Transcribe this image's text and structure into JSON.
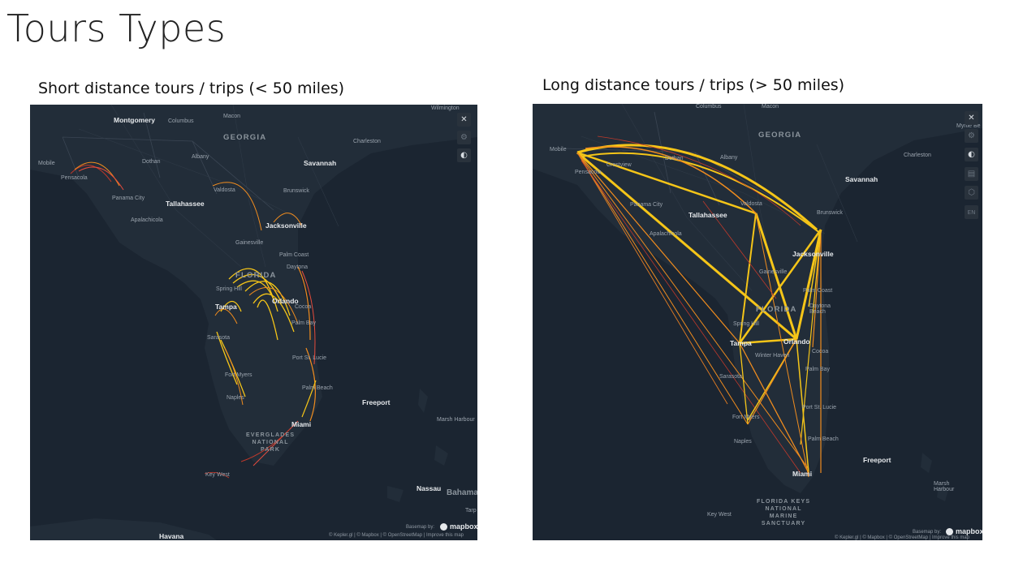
{
  "slide": {
    "title": "Tours Types"
  },
  "panels": [
    {
      "heading": "Short distance tours / trips (< 50 miles)",
      "labels": {
        "states": [
          "GEORGIA",
          "FLORIDA"
        ],
        "park": "EVERGLADES\nNATIONAL\nPARK",
        "cities_major": [
          "Tallahassee",
          "Jacksonville",
          "Savannah",
          "Montgomery",
          "Tampa",
          "Orlando",
          "Miami",
          "Freeport",
          "Havana",
          "Nassau",
          "Bahamas"
        ],
        "cities_minor": [
          "Columbus",
          "Macon",
          "Wilmington",
          "Albany",
          "Charleston",
          "Dothan",
          "Mobile",
          "Pensacola",
          "Panama City",
          "Apalachicola",
          "Valdosta",
          "Brunswick",
          "Gainesville",
          "Palm Coast",
          "Daytona",
          "Spring Hill",
          "Cocoa",
          "Palm Bay",
          "Sarasota",
          "Port St. Lucie",
          "Fort Myers",
          "Naples",
          "Palm Beach",
          "Key West",
          "Marsh Harbour",
          "Tarp"
        ]
      },
      "controls": [
        "✕",
        "⚙",
        "◐"
      ],
      "attribution": "© Kepler.gl | © Mapbox | © OpenStreetMap | Improve this map",
      "basemap_by": "Basemap by:",
      "logo": "mapbox"
    },
    {
      "heading": "Long distance tours / trips (> 50 miles)",
      "labels": {
        "states": [
          "GEORGIA",
          "FLORIDA"
        ],
        "park": "FLORIDA KEYS\nNATIONAL\nMARINE\nSANCTUARY",
        "cities_major": [
          "Tallahassee",
          "Jacksonville",
          "Savannah",
          "Tampa",
          "Orlando",
          "Miami",
          "Freeport"
        ],
        "cities_minor": [
          "Columbus",
          "Macon",
          "Myrtle Be",
          "Charleston",
          "Albany",
          "Dothan",
          "Mobile",
          "Pensacola",
          "Crestview",
          "Panama City",
          "Apalachicola",
          "Valdosta",
          "Brunswick",
          "Gainesville",
          "Palm Coast",
          "Daytona Beach",
          "Spring Hill",
          "Winter Haven",
          "Cocoa",
          "Palm Bay",
          "Sarasota",
          "Port St. Lucie",
          "Fort Myers",
          "Naples",
          "Palm Beach",
          "Key West",
          "Marsh Harbour"
        ]
      },
      "controls": [
        "✕",
        "⚙",
        "◐",
        "▤",
        "⬡",
        "EN"
      ],
      "attribution": "© Kepler.gl | © Mapbox | © OpenStreetMap | Improve this map",
      "basemap_by": "Basemap by:",
      "logo": "mapbox"
    }
  ],
  "colors": {
    "map_bg": "#1b2531",
    "land": "#1f2a36",
    "water": "#17202a",
    "arc_yellow": "#f5c518",
    "arc_orange": "#f08c1e",
    "arc_red": "#c0392b"
  }
}
